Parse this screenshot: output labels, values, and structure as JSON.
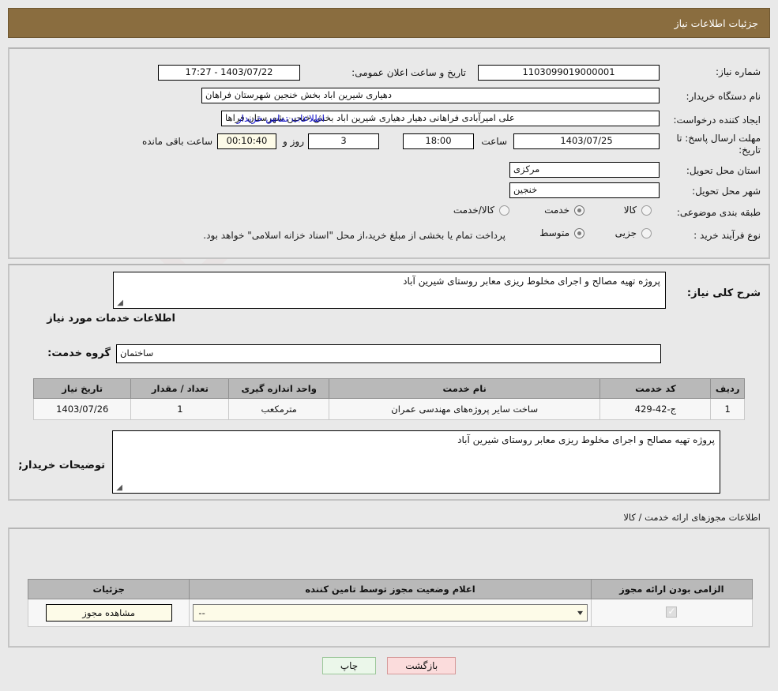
{
  "header": {
    "title": "جزئیات اطلاعات نیاز"
  },
  "watermark": {
    "text": "AnaTender.neT"
  },
  "main": {
    "need_number_label": "شماره نیاز:",
    "need_number_value": "1103099019000001",
    "announce_label": "تاریخ و ساعت اعلان عمومی:",
    "announce_value": "1403/07/22 - 17:27",
    "buyer_org_label": "نام دستگاه خریدار:",
    "buyer_org_value": "دهیاری شیرین اباد بخش خنجین  شهرستان فراهان",
    "creator_label": "ایجاد کننده درخواست:",
    "creator_value": "علی امیرآبادی فراهانی دهیار دهیاری شیرین اباد بخش خنجین  شهرستان فراها",
    "contact_link": "اطلاعات تماس خریدار",
    "deadline_label": "مهلت ارسال پاسخ: تا تاریخ:",
    "deadline_date": "1403/07/25",
    "hour_label": "ساعت",
    "deadline_time": "18:00",
    "days_value": "3",
    "days_label": "روز و",
    "countdown_value": "00:10:40",
    "remaining_label": "ساعت باقی مانده",
    "province_label": "استان محل تحویل:",
    "province_value": "مرکزی",
    "city_label": "شهر محل تحویل:",
    "city_value": "خنجین",
    "category_label": "طبقه بندی موضوعی:",
    "category_options": [
      "کالا",
      "خدمت",
      "کالا/خدمت"
    ],
    "category_selected": "خدمت",
    "process_label": "نوع فرآیند خرید :",
    "process_options": [
      "جزیی",
      "متوسط"
    ],
    "process_selected": "متوسط",
    "process_note": "پرداخت تمام یا بخشی از مبلغ خرید،از محل \"اسناد خزانه اسلامی\" خواهد بود."
  },
  "description": {
    "summary_label": "شرح کلی نیاز:",
    "summary_value": "پروژه تهیه مصالح و اجرای مخلوط ریزی معابر  روستای شیرین آباد",
    "services_heading": "اطلاعات خدمات مورد نیاز",
    "service_group_label": "گروه خدمت:",
    "service_group_value": "ساختمان",
    "buyer_notes_label": "توضیحات خریدار;",
    "buyer_notes_value": "پروژه تهیه مصالح و اجرای مخلوط ریزی معابر  روستای شیرین آباد"
  },
  "services_table": {
    "columns": [
      "ردیف",
      "کد خدمت",
      "نام خدمت",
      "واحد اندازه گیری",
      "تعداد / مقدار",
      "تاریخ نیاز"
    ],
    "rows": [
      [
        "1",
        "ج-42-429",
        "ساخت سایر پروژه‌های مهندسی عمران",
        "مترمکعب",
        "1",
        "1403/07/26"
      ]
    ]
  },
  "permits": {
    "heading": "اطلاعات مجوزهای ارائه خدمت / کالا",
    "columns": [
      "الزامی بودن ارائه مجوز",
      "اعلام وضعیت مجوز توسط تامین کننده",
      "جزئیات"
    ],
    "rows": [
      {
        "required": true,
        "status_value": "--",
        "detail_label": "مشاهده مجوز"
      }
    ]
  },
  "footer": {
    "print_label": "چاپ",
    "back_label": "بازگشت"
  },
  "colors": {
    "title_bar": "#8a6d3f",
    "link": "#1414cc",
    "table_header": "#b9b9b9",
    "page_bg": "#e9e9e9",
    "print_btn": "#ebf7ea",
    "back_btn": "#fbdcdc"
  }
}
